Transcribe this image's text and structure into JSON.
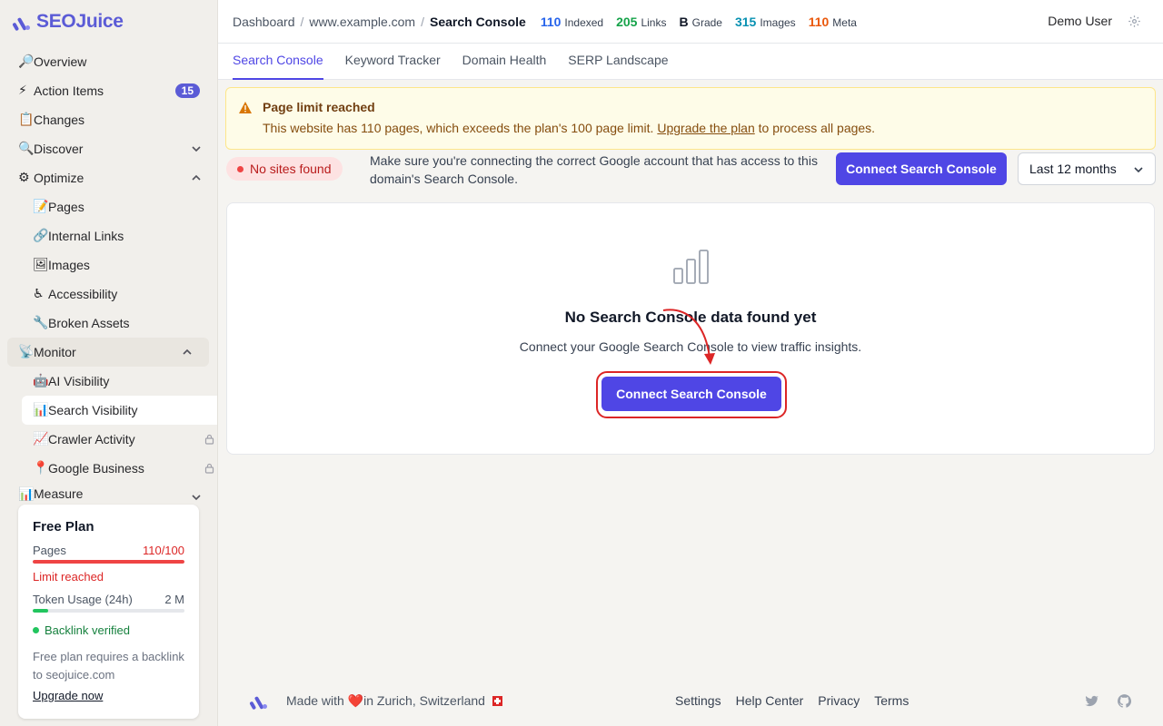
{
  "brand": {
    "name": "SEOJuice",
    "color": "#5b5bd6"
  },
  "sidebar": {
    "items": [
      {
        "emoji": "🔎",
        "label": "Overview"
      },
      {
        "emoji": "⚡",
        "label": "Action Items",
        "badge": "15"
      },
      {
        "emoji": "📋",
        "label": "Changes"
      },
      {
        "emoji": "🔍",
        "label": "Discover",
        "chevron": "down"
      },
      {
        "emoji": "⚙",
        "label": "Optimize",
        "chevron": "up"
      },
      {
        "emoji": "📝",
        "label": "Pages"
      },
      {
        "emoji": "🔗",
        "label": "Internal Links"
      },
      {
        "emoji": "🖼",
        "label": "Images"
      },
      {
        "emoji": "♿",
        "label": "Accessibility"
      },
      {
        "emoji": "🔧",
        "label": "Broken Assets"
      },
      {
        "emoji": "📡",
        "label": "Monitor",
        "chevron": "up"
      },
      {
        "emoji": "🤖",
        "label": "AI Visibility"
      },
      {
        "emoji": "📊",
        "label": "Search Visibility",
        "active": true
      },
      {
        "emoji": "📈",
        "label": "Crawler Activity",
        "locked": true
      },
      {
        "emoji": "📍",
        "label": "Google Business",
        "locked": true
      },
      {
        "emoji": "📊",
        "label": "Measure",
        "chevron": "down"
      }
    ]
  },
  "plan": {
    "title": "Free Plan",
    "pages_label": "Pages",
    "pages_value": "110/100",
    "pages_progress": 1.0,
    "limit_text": "Limit reached",
    "token_label": "Token Usage (24h)",
    "token_value": "2 M",
    "token_progress": 0.1,
    "verified_text": "Backlink verified",
    "note": "Free plan requires a backlink to seojuice.com",
    "upgrade_label": "Upgrade now"
  },
  "topbar": {
    "breadcrumb": [
      "Dashboard",
      "www.example.com",
      "Search Console"
    ],
    "stats": [
      {
        "value": "110",
        "label": "Indexed",
        "color": "#2563eb"
      },
      {
        "value": "205",
        "label": "Links",
        "color": "#16a34a"
      },
      {
        "value": "B",
        "label": "Grade",
        "color": "#111827"
      },
      {
        "value": "315",
        "label": "Images",
        "color": "#0891b2"
      },
      {
        "value": "110",
        "label": "Meta",
        "color": "#ea580c"
      }
    ],
    "user": "Demo User"
  },
  "tabs": [
    {
      "label": "Search Console",
      "active": true
    },
    {
      "label": "Keyword Tracker"
    },
    {
      "label": "Domain Health"
    },
    {
      "label": "SERP Landscape"
    }
  ],
  "alert": {
    "title": "Page limit reached",
    "body_before": "This website has 110 pages, which exceeds the plan's 100 page limit. ",
    "link": "Upgrade the plan",
    "body_after": " to process all pages."
  },
  "status": {
    "badge": "No sites found",
    "hint": "Make sure you're connecting the correct Google account that has access to this domain's Search Console.",
    "connect_label": "Connect Search Console",
    "range": "Last 12 months"
  },
  "empty": {
    "title": "No Search Console data found yet",
    "subtitle": "Connect your Google Search Console to view traffic insights.",
    "button": "Connect Search Console"
  },
  "footer": {
    "made_before": "Made with ",
    "heart": "❤️",
    "made_after": "in Zurich, Switzerland",
    "links": [
      "Settings",
      "Help Center",
      "Privacy",
      "Terms"
    ]
  }
}
